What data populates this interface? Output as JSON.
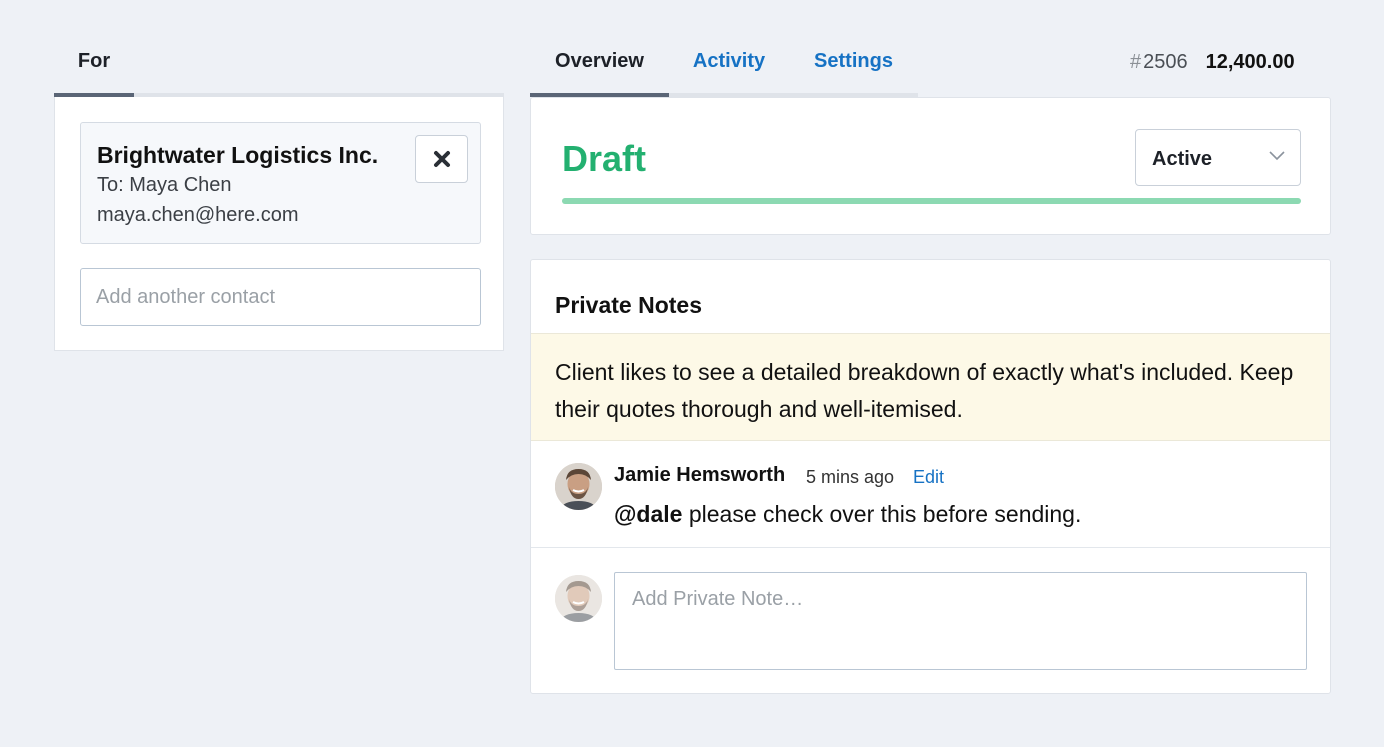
{
  "left": {
    "tab_label": "For",
    "contact": {
      "company": "Brightwater Logistics Inc.",
      "to_line": "To: Maya Chen",
      "email": "maya.chen@here.com",
      "remove_icon": "close-icon"
    },
    "add_contact_placeholder": "Add another contact"
  },
  "tabs": [
    {
      "label": "Overview",
      "active": true
    },
    {
      "label": "Activity",
      "active": false
    },
    {
      "label": "Settings",
      "active": false
    }
  ],
  "quote": {
    "hash": "#",
    "number": "2506",
    "total": "12,400.00"
  },
  "status": {
    "label": "Draft",
    "select_value": "Active",
    "progress": 1.0,
    "colors": {
      "status": "#23b070",
      "progress": "#8cd9b2"
    }
  },
  "notes": {
    "title": "Private Notes",
    "pinned": "Client likes to see a detailed breakdown of exactly what's included. Keep their quotes thorough and well-itemised.",
    "items": [
      {
        "author": "Jamie Hemsworth",
        "time": "5 mins ago",
        "edit_label": "Edit",
        "mention": "@dale",
        "text": " please check over this before sending."
      }
    ],
    "compose_placeholder": "Add Private Note…"
  },
  "colors": {
    "link": "#1672c4",
    "accent_green": "#23b070",
    "note_bg": "#fdf9e7"
  }
}
